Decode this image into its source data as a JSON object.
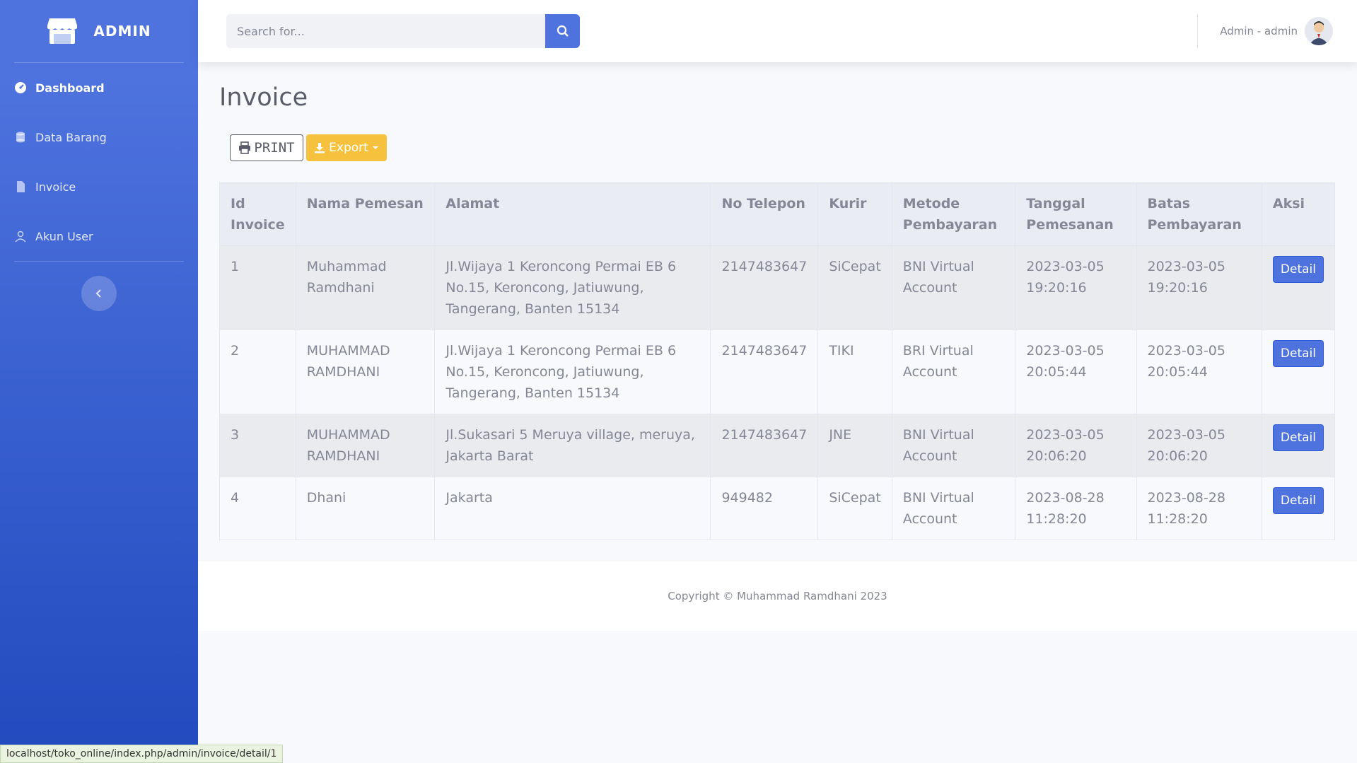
{
  "sidebar": {
    "brand": "ADMIN",
    "items": [
      {
        "label": "Dashboard",
        "icon": "tachometer-icon"
      },
      {
        "label": "Data Barang",
        "icon": "database-icon"
      },
      {
        "label": "Invoice",
        "icon": "file-icon"
      },
      {
        "label": "Akun User",
        "icon": "user-icon"
      }
    ]
  },
  "topbar": {
    "search_placeholder": "Search for...",
    "user_name": "Admin - admin"
  },
  "page": {
    "title": "Invoice",
    "print_label": "PRINT",
    "export_label": "Export"
  },
  "table": {
    "headers": [
      "Id Invoice",
      "Nama Pemesan",
      "Alamat",
      "No Telepon",
      "Kurir",
      "Metode Pembayaran",
      "Tanggal Pemesanan",
      "Batas Pembayaran",
      "Aksi"
    ],
    "rows": [
      {
        "id": "1",
        "nama": "Muhammad Ramdhani",
        "alamat": "Jl.Wijaya 1 Keroncong Permai EB 6 No.15, Keroncong, Jatiuwung, Tangerang, Banten 15134",
        "telepon": "2147483647",
        "kurir": "SiCepat",
        "metode": "BNI Virtual Account",
        "tanggal": "2023-03-05 19:20:16",
        "batas": "2023-03-05 19:20:16",
        "aksi": "Detail"
      },
      {
        "id": "2",
        "nama": "MUHAMMAD RAMDHANI",
        "alamat": "Jl.Wijaya 1 Keroncong Permai EB 6 No.15, Keroncong, Jatiuwung, Tangerang, Banten 15134",
        "telepon": "2147483647",
        "kurir": "TIKI",
        "metode": "BRI Virtual Account",
        "tanggal": "2023-03-05 20:05:44",
        "batas": "2023-03-05 20:05:44",
        "aksi": "Detail"
      },
      {
        "id": "3",
        "nama": "MUHAMMAD RAMDHANI",
        "alamat": "Jl.Sukasari 5 Meruya village, meruya, Jakarta Barat",
        "telepon": "2147483647",
        "kurir": "JNE",
        "metode": "BNI Virtual Account",
        "tanggal": "2023-03-05 20:06:20",
        "batas": "2023-03-05 20:06:20",
        "aksi": "Detail"
      },
      {
        "id": "4",
        "nama": "Dhani",
        "alamat": "Jakarta",
        "telepon": "949482",
        "kurir": "SiCepat",
        "metode": "BNI Virtual Account",
        "tanggal": "2023-08-28 11:28:20",
        "batas": "2023-08-28 11:28:20",
        "aksi": "Detail"
      }
    ]
  },
  "footer": {
    "copyright": "Copyright © Muhammad Ramdhani 2023"
  },
  "status_bar": {
    "url": "localhost/toko_online/index.php/admin/invoice/detail/1"
  },
  "colors": {
    "primary": "#4e73df",
    "warning": "#f6c23e",
    "text": "#858796"
  }
}
